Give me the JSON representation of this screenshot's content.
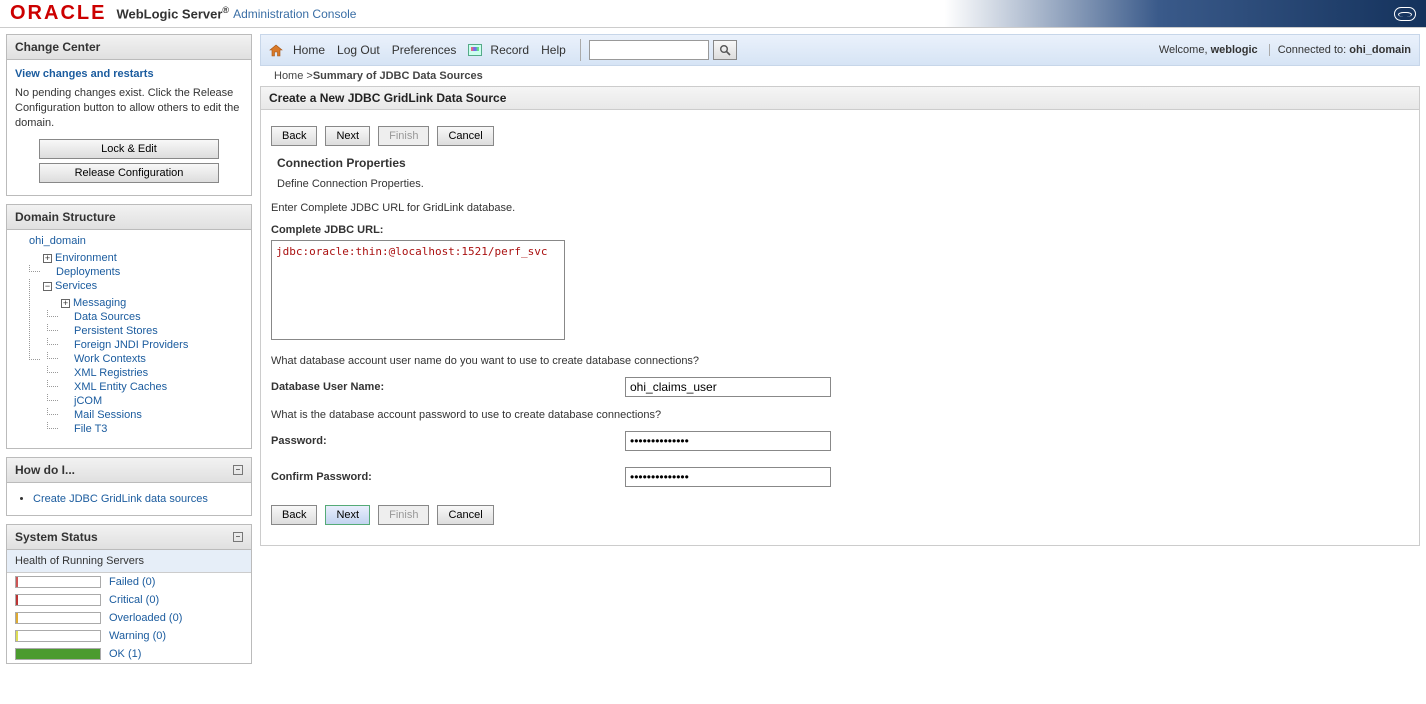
{
  "brand": {
    "logo": "ORACLE",
    "product": "WebLogic Server",
    "console": "Administration Console"
  },
  "toolbar": {
    "home": "Home",
    "logout": "Log Out",
    "preferences": "Preferences",
    "record": "Record",
    "help": "Help",
    "search_placeholder": "",
    "welcome_label": "Welcome, ",
    "welcome_user": "weblogic",
    "connected_label": "Connected to: ",
    "connected_domain": "ohi_domain"
  },
  "breadcrumb": {
    "home": "Home",
    "sep": " >",
    "current": "Summary of JDBC Data Sources"
  },
  "change_center": {
    "title": "Change Center",
    "view_link": "View changes and restarts",
    "pending": "No pending changes exist. Click the Release Configuration button to allow others to edit the domain.",
    "lock_btn": "Lock & Edit",
    "release_btn": "Release Configuration"
  },
  "domain_structure": {
    "title": "Domain Structure",
    "root": "ohi_domain",
    "nodes": {
      "environment": "Environment",
      "deployments": "Deployments",
      "services": "Services",
      "messaging": "Messaging",
      "data_sources": "Data Sources",
      "persistent_stores": "Persistent Stores",
      "foreign_jndi": "Foreign JNDI Providers",
      "work_contexts": "Work Contexts",
      "xml_registries": "XML Registries",
      "xml_entity_caches": "XML Entity Caches",
      "jcom": "jCOM",
      "mail": "Mail Sessions",
      "file_t3": "File T3"
    }
  },
  "howdo": {
    "title": "How do I...",
    "items": [
      "Create JDBC GridLink data sources"
    ]
  },
  "status": {
    "title": "System Status",
    "subtitle": "Health of Running Servers",
    "items": [
      {
        "label": "Failed (0)",
        "class": "failed"
      },
      {
        "label": "Critical (0)",
        "class": "critical"
      },
      {
        "label": "Overloaded (0)",
        "class": "overloaded"
      },
      {
        "label": "Warning (0)",
        "class": "warning"
      },
      {
        "label": "OK (1)",
        "class": "ok"
      }
    ]
  },
  "form": {
    "title": "Create a New JDBC GridLink Data Source",
    "buttons": {
      "back": "Back",
      "next": "Next",
      "finish": "Finish",
      "cancel": "Cancel"
    },
    "section_heading": "Connection Properties",
    "section_desc": "Define Connection Properties.",
    "jdbc_instr": "Enter Complete JDBC URL for GridLink database.",
    "jdbc_label": "Complete JDBC URL:",
    "jdbc_value": "jdbc:oracle:thin:@localhost:1521/perf_svc",
    "username_q": "What database account user name do you want to use to create database connections?",
    "username_label": "Database User Name:",
    "username_value": "ohi_claims_user",
    "password_q": "What is the database account password to use to create database connections?",
    "password_label": "Password:",
    "password_value": "••••••••••••••",
    "confirm_label": "Confirm Password:",
    "confirm_value": "••••••••••••••"
  }
}
